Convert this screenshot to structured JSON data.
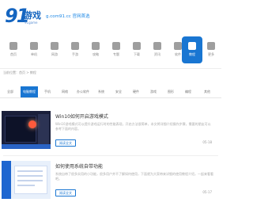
{
  "header": {
    "logo_number": "91",
    "logo_text": "游戏",
    "logo_sub": "91game",
    "slogan": "g.com91.cc 官网首选"
  },
  "nav": {
    "items": [
      {
        "label": "首页"
      },
      {
        "label": "单机"
      },
      {
        "label": "网游"
      },
      {
        "label": "手游"
      },
      {
        "label": "攻略"
      },
      {
        "label": "专题"
      },
      {
        "label": "下载"
      },
      {
        "label": "资讯"
      },
      {
        "label": "软件"
      },
      {
        "label": "教程"
      },
      {
        "label": "更多"
      }
    ]
  },
  "breadcrumb": "当前位置：首页 > 教程",
  "tabs": [
    {
      "label": "全部",
      "active": false
    },
    {
      "label": "电脑教程",
      "active": true
    },
    {
      "label": "手机",
      "active": false
    },
    {
      "label": "网络",
      "active": false
    },
    {
      "label": "办公软件",
      "active": false
    },
    {
      "label": "系统",
      "active": false
    },
    {
      "label": "安全",
      "active": false
    },
    {
      "label": "硬件",
      "active": false
    },
    {
      "label": "游戏",
      "active": false
    },
    {
      "label": "图形",
      "active": false
    },
    {
      "label": "编程",
      "active": false
    },
    {
      "label": "其他",
      "active": false
    }
  ],
  "articles": [
    {
      "title": "Win10如何开启游戏模式",
      "desc": "Win10游戏模式可以提升游戏运行时的性能表现，开启方法很简单，本文将详细介绍操作步骤，需要的朋友可以参考下面的内容。",
      "button": "阅读全文",
      "date": "05-18"
    },
    {
      "title": "如何使用系统自带功能",
      "desc": "系统自带了很多实用的小功能，很多用户并不了解如何使用，下面就为大家带来详细的使用教程介绍，一起来看看吧。",
      "button": "阅读全文",
      "date": "05-17"
    }
  ]
}
